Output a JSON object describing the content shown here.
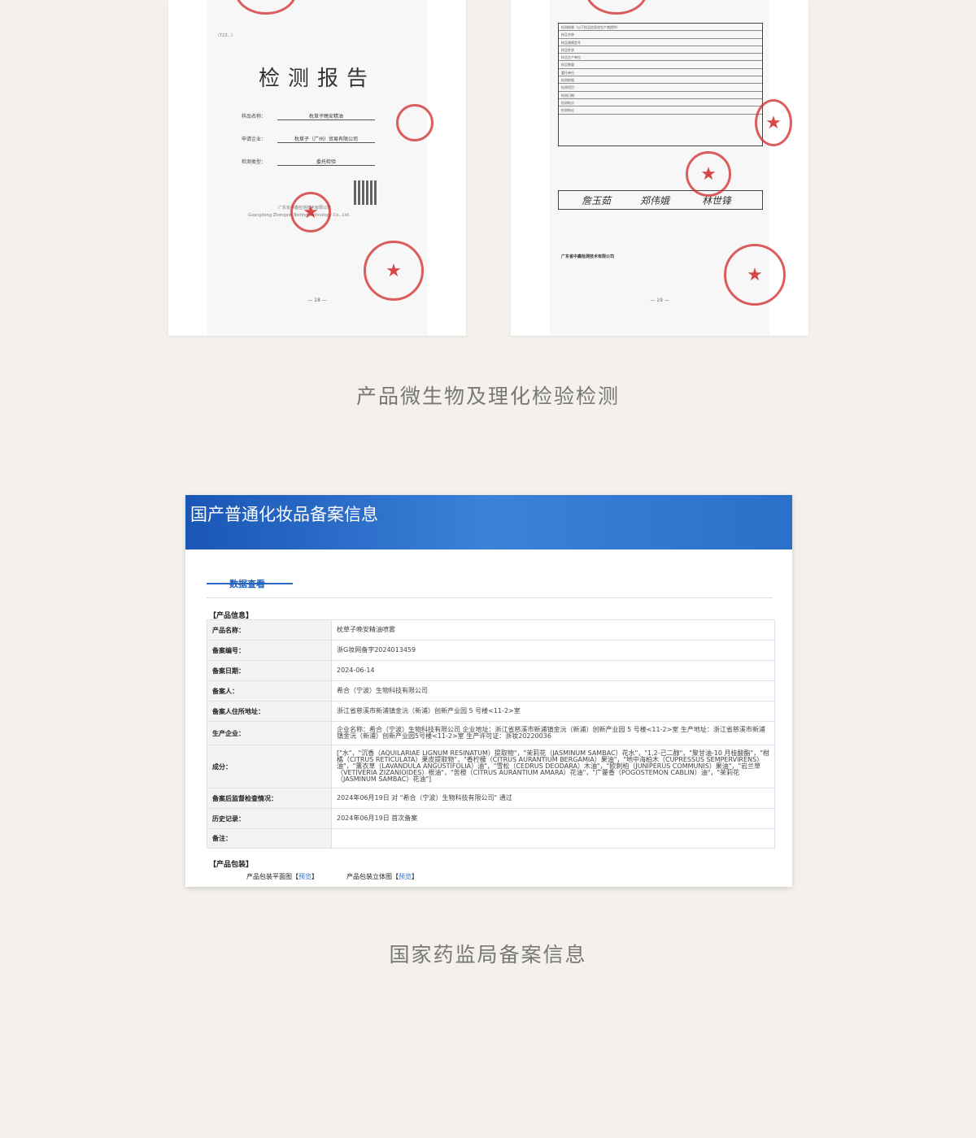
{
  "reports": {
    "left": {
      "report_no": "（T23...）",
      "title": "检测报告",
      "fields": [
        {
          "label": "样品名称：",
          "value": "枕草子晚安精油"
        },
        {
          "label": "申请企业：",
          "value": "枕草子（广州）贸易有限公司"
        },
        {
          "label": "检测类型：",
          "value": "委托检验"
        }
      ],
      "company_cn": "广东省中鑫检测技术有限公司",
      "company_en": "Guangdong Zhongxin Testing Technology Co., Ltd.",
      "page_number": "— 18 —"
    },
    "right": {
      "table_rows": [
        "检测结果（以下样品信息由生产商提供）",
        "样品名称",
        "样品规格型号",
        "样品性状",
        "样品生产单位",
        "样品数量",
        "委托单位",
        "检测依据",
        "检测项目",
        "检测日期",
        "检测地点",
        "检测结论"
      ],
      "signatures": [
        "詹玉茹",
        "郑伟娥",
        "林世锋"
      ],
      "company": "广东省中鑫检测技术有限公司",
      "page_number": "— 19 —"
    }
  },
  "caption_top": "产品微生物及理化检验检测",
  "registry": {
    "title": "国产普通化妆品备案信息",
    "tab_label": "数据查看",
    "section_product": "【产品信息】",
    "rows": [
      {
        "key": "产品名称：",
        "value": "枕草子晚安精油喷雾"
      },
      {
        "key": "备案编号：",
        "value": "浙G妆网备字2024013459"
      },
      {
        "key": "备案日期：",
        "value": "2024-06-14"
      },
      {
        "key": "备案人：",
        "value": "希合（宁波）生物科技有限公司"
      },
      {
        "key": "备案人住所地址：",
        "value": "浙江省慈溪市新浦镇金沅（新浦）创新产业园 5 号楼<11-2>室"
      },
      {
        "key": "生产企业：",
        "value": "企业名称：希合（宁波）生物科技有限公司 企业地址：浙江省慈溪市新浦镇金沅（新浦）创新产业园 5 号楼<11-2>室 生产地址：浙江省慈溪市新浦镇金沅（新浦）创新产业园5号楼<11-2>室 生产许可证：浙妆20220036"
      },
      {
        "key": "成分：",
        "value": "[\"水\"，\"沉香（AQUILARIAE LIGNUM RESINATUM）提取物\"，\"茉莉花（JASMINUM SAMBAC）花水\"，\"1,2-己二醇\"，\"聚甘油-10 月桂酸酯\"，\"柑橘（CITRUS RETICULATA）果皮提取物\"，\"香柠檬（CITRUS AURANTIUM BERGAMIA）果油\"，\"地中海柏木（CUPRESSUS SEMPERVIRENS）油\"，\"薰衣草（LAVANDULA ANGUSTIFOLIA）油\"，\"雪松（CEDRUS DEODARA）木油\"，\"欧刺柏（JUNIPERUS COMMUNIS）果油\"，\"岩兰草（VETIVERIA ZIZANIOIDES）根油\"，\"苦橙（CITRUS AURANTIUM AMARA）花油\"，\"广藿香（POGOSTEMON CABLIN）油\"，\"茉莉花（JASMINUM SAMBAC）花油\"]"
      },
      {
        "key": "备案后监督检查情况：",
        "value": "2024年06月19日 对 \"希合（宁波）生物科技有限公司\" 通过"
      },
      {
        "key": "历史记录：",
        "value": "2024年06月19日 首次备案"
      },
      {
        "key": "备注：",
        "value": ""
      }
    ],
    "section_package": "【产品包装】",
    "package": [
      {
        "label": "产品包装平面图",
        "link": "预览"
      },
      {
        "label": "产品包装立体图",
        "link": "预览"
      }
    ]
  },
  "caption_bottom": "国家药监局备案信息"
}
